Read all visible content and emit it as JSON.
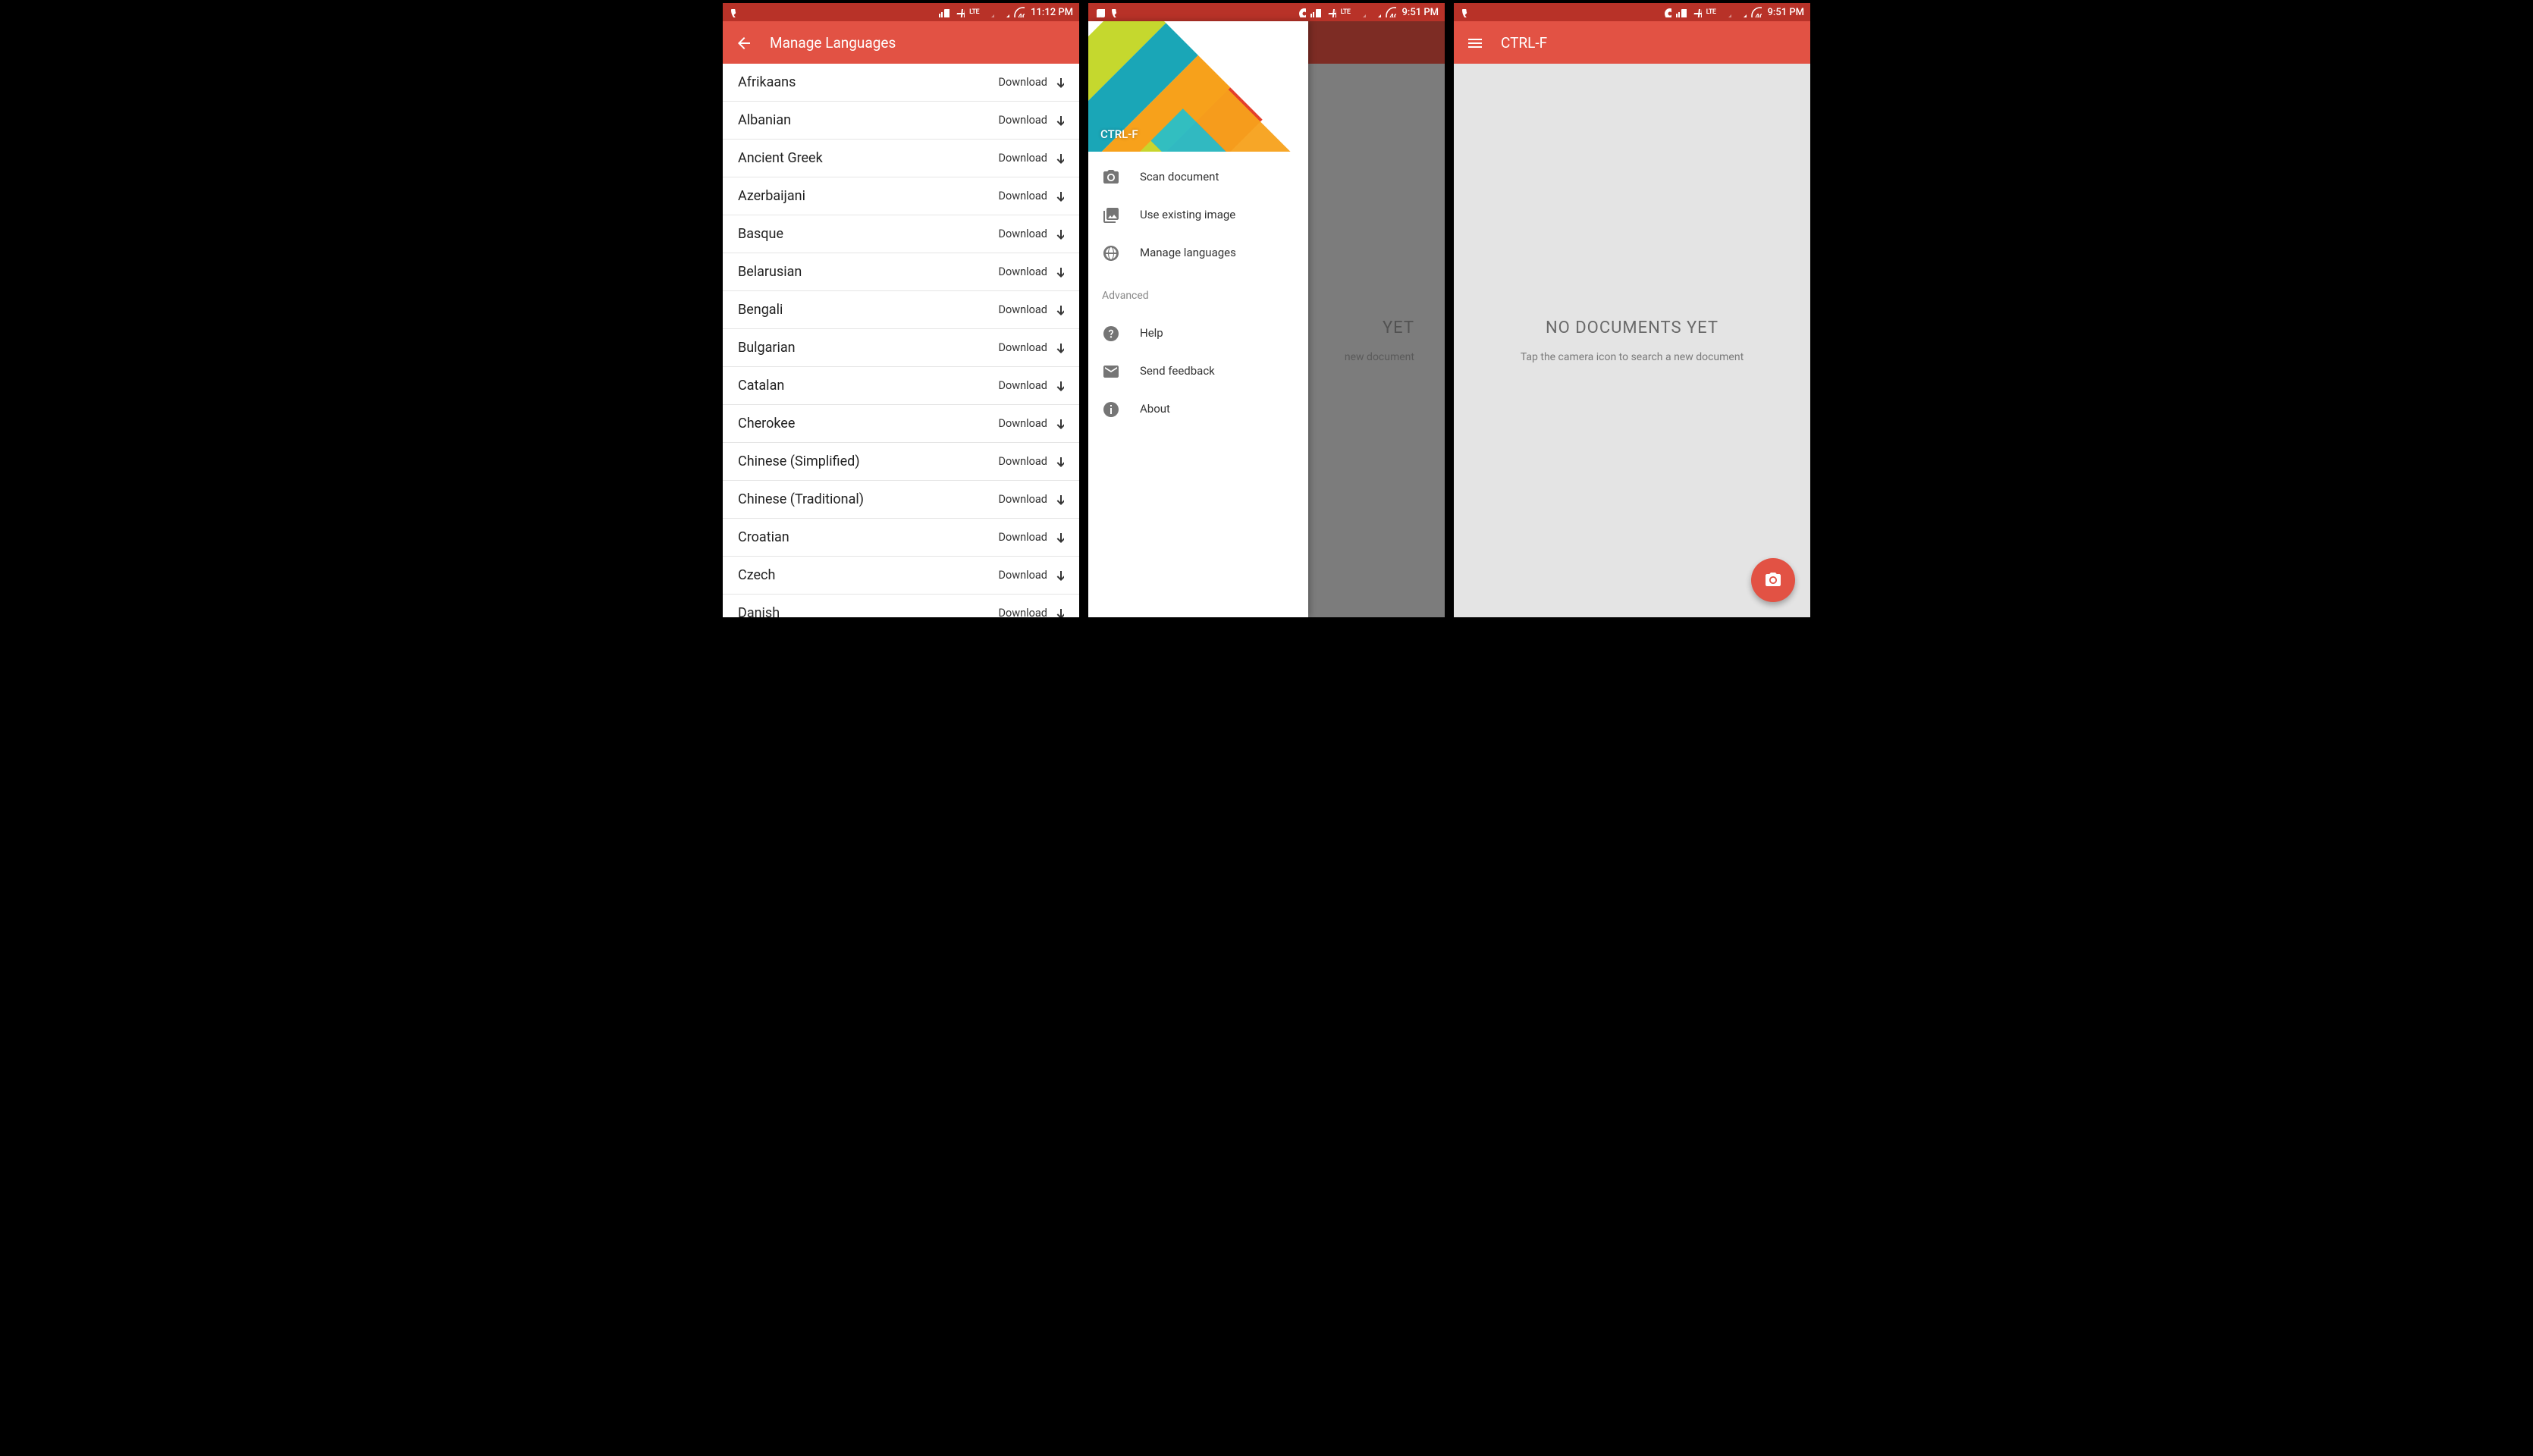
{
  "colors": {
    "primary": "#e25244",
    "primary_dark": "#b83228"
  },
  "screen1": {
    "status": {
      "time": "11:12 PM",
      "lte": "LTE"
    },
    "appbar_title": "Manage Languages",
    "download_label": "Download",
    "languages": [
      "Afrikaans",
      "Albanian",
      "Ancient Greek",
      "Azerbaijani",
      "Basque",
      "Belarusian",
      "Bengali",
      "Bulgarian",
      "Catalan",
      "Cherokee",
      "Chinese (Simplified)",
      "Chinese (Traditional)",
      "Croatian",
      "Czech",
      "Danish"
    ]
  },
  "screen2": {
    "status": {
      "time": "9:51 PM",
      "lte": "LTE"
    },
    "brand": "CTRL-F",
    "bg_heading_fragment": "YET",
    "bg_sub_fragment": "new document",
    "drawer": {
      "items": [
        {
          "icon": "camera",
          "label": "Scan document"
        },
        {
          "icon": "image-stack",
          "label": "Use existing image"
        },
        {
          "icon": "globe",
          "label": "Manage languages"
        }
      ],
      "section_label": "Advanced",
      "advanced": [
        {
          "icon": "help",
          "label": "Help"
        },
        {
          "icon": "mail",
          "label": "Send feedback"
        },
        {
          "icon": "info",
          "label": "About"
        }
      ]
    }
  },
  "screen3": {
    "status": {
      "time": "9:51 PM",
      "lte": "LTE"
    },
    "appbar_title": "CTRL-F",
    "empty_heading": "NO DOCUMENTS YET",
    "empty_sub": "Tap the camera icon to search a new document"
  }
}
